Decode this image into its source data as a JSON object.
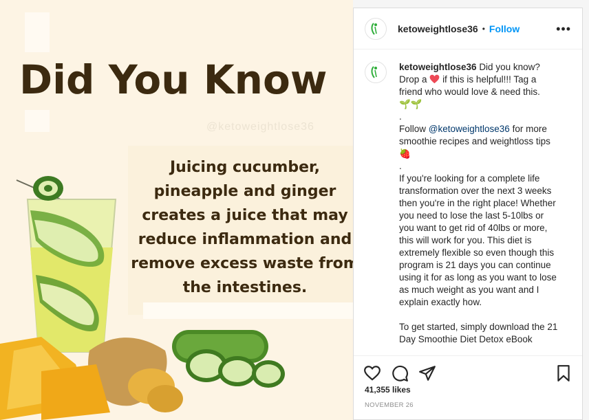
{
  "media": {
    "headline": "Did You Know",
    "watermark": "@ketoweightlose36",
    "fact": "Juicing cucumber, pineapple and ginger creates a juice that may reduce inflammation and remove excess waste from the intestines."
  },
  "post": {
    "username": "ketoweightlose36",
    "dot": "•",
    "follow_label": "Follow",
    "more_label": "•••",
    "caption": {
      "lead": "Did you know?",
      "line1_before": "Drop a",
      "line1_after": "if this is helpful!!! Tag a friend who would love & need this.",
      "emoji_sprouts": "🌱🌱",
      "dot1": ".",
      "line2_before": "Follow",
      "mention": "@ketoweightlose36",
      "line2_after": "for more smoothie recipes and weightloss tips",
      "emoji_strawberry": "🍓",
      "dot2": ".",
      "para1": "If you're looking for a complete life transformation over the next 3 weeks then you're in the right place! Whether you need to lose the last 5-10lbs or you want to get rid of 40lbs or more, this will work for you. This diet is extremely flexible so even though this program is 21 days you can continue using it for as long as you want to lose as much weight as you want and I explain exactly how.",
      "para2": "To get started, simply download the 21 Day Smoothie Diet Detox eBook"
    },
    "likes": "41,355 likes",
    "date": "NOVEMBER 26"
  },
  "colors": {
    "follow": "#0095f6",
    "heart": "#ed4956",
    "headline": "#3c2a10",
    "media_bg": "#fdf4e4"
  },
  "icons": [
    "like-icon",
    "comment-icon",
    "share-icon",
    "save-icon",
    "more-options-icon"
  ]
}
